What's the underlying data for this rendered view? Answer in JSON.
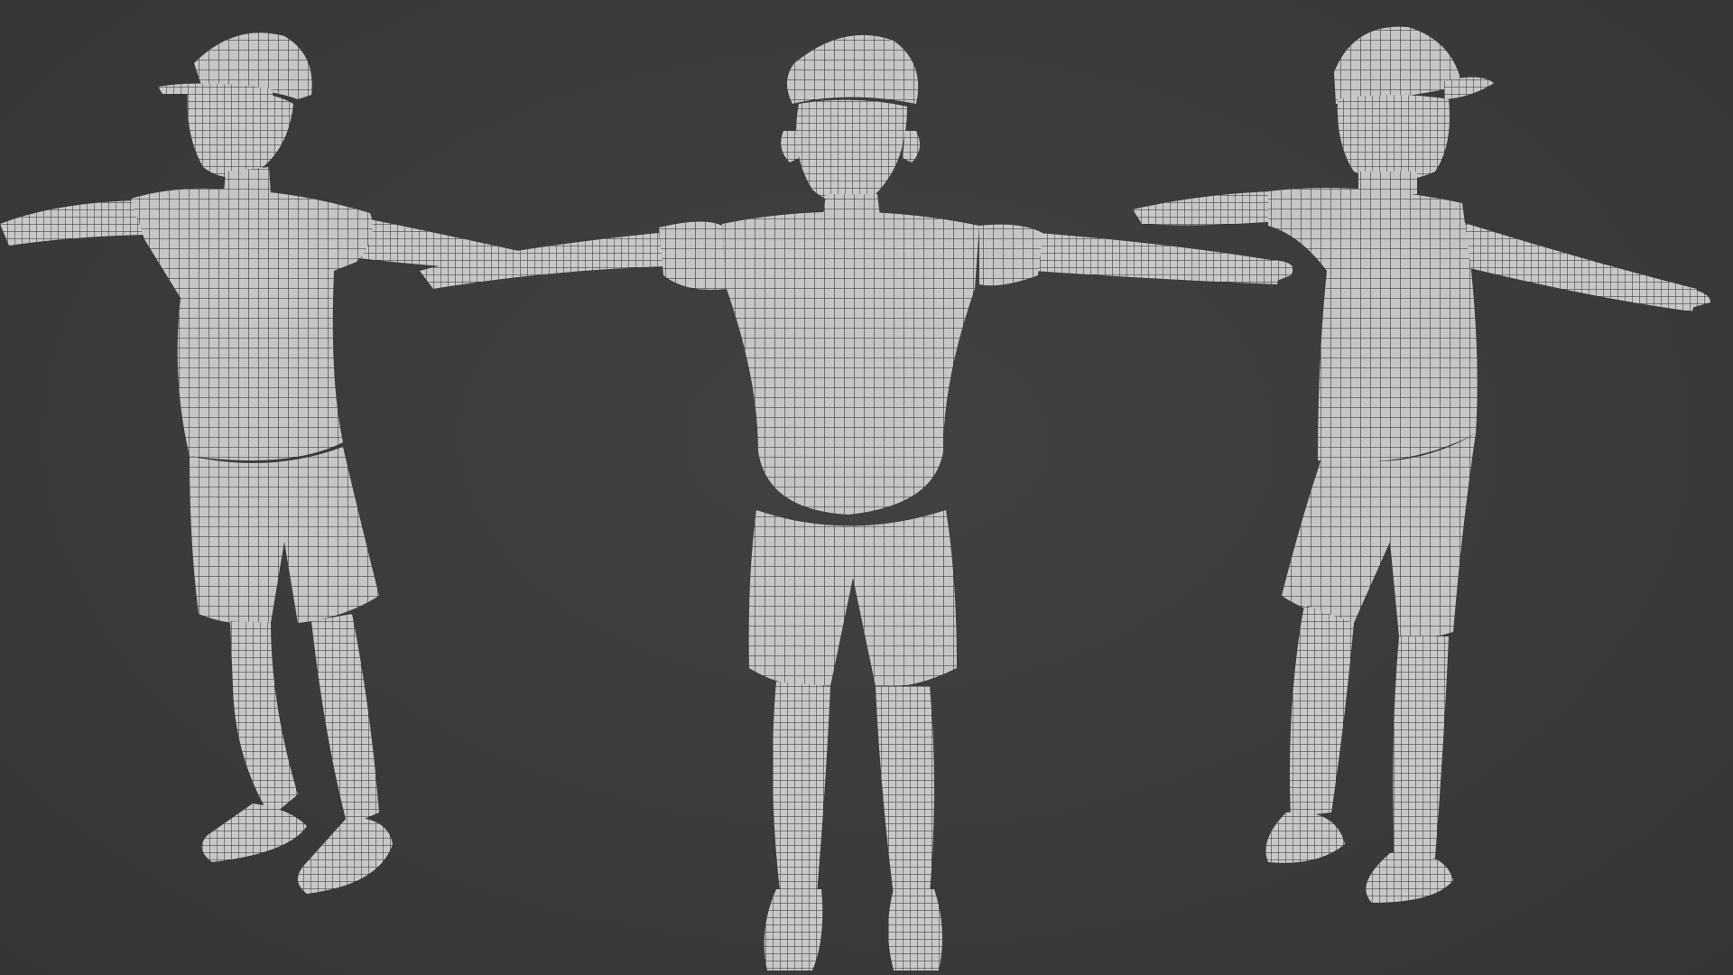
{
  "viewport": {
    "background_color": "#3a3a3b",
    "mesh_color": "#c9c9c9",
    "wire_color": "#2a2a2a"
  },
  "figures": [
    {
      "view": "three-quarter-left",
      "icon": "character-mesh"
    },
    {
      "view": "front",
      "icon": "character-mesh"
    },
    {
      "view": "back-three-quarter",
      "icon": "character-mesh"
    }
  ]
}
